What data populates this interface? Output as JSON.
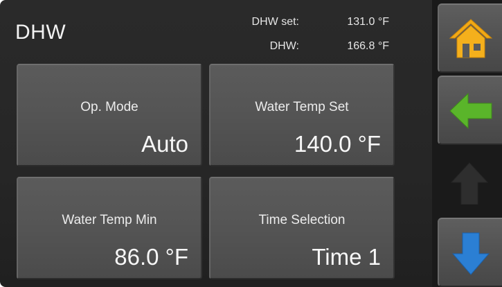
{
  "header": {
    "title": "DHW",
    "set_label": "DHW set:",
    "set_value": "131.0 °F",
    "actual_label": "DHW:",
    "actual_value": "166.8 °F"
  },
  "tiles": [
    {
      "label": "Op. Mode",
      "value": "Auto"
    },
    {
      "label": "Water Temp Set",
      "value": "140.0 °F"
    },
    {
      "label": "Water Temp Min",
      "value": "86.0 °F"
    },
    {
      "label": "Time Selection",
      "value": "Time 1"
    }
  ],
  "sidebar": {
    "home_icon": "home-icon",
    "back_icon": "arrow-left-icon",
    "up_icon": "arrow-up-icon",
    "down_icon": "arrow-down-icon",
    "up_enabled": false
  },
  "colors": {
    "home": "#f2a915",
    "back": "#5ab52a",
    "up_disabled": "#2e2e2e",
    "down": "#2b7fd4"
  }
}
